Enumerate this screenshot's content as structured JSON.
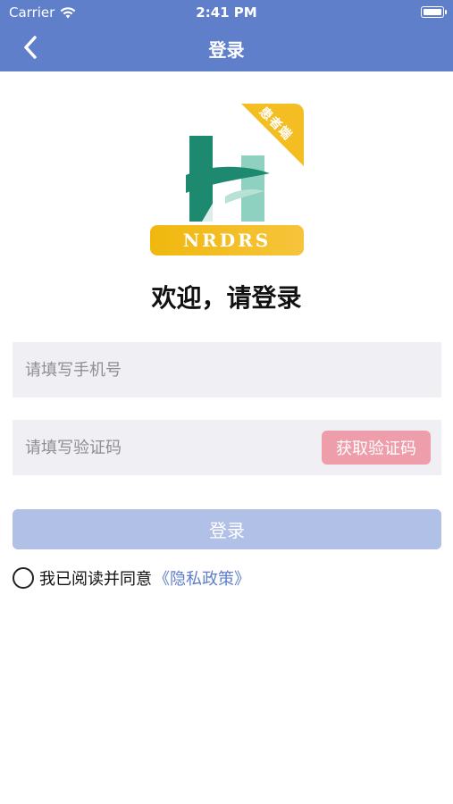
{
  "status_bar": {
    "carrier": "Carrier",
    "time": "2:41 PM"
  },
  "nav": {
    "title": "登录"
  },
  "logo": {
    "badge_text": "患者端",
    "banner_text": "NRDRS"
  },
  "welcome": "欢迎，请登录",
  "form": {
    "phone_placeholder": "请填写手机号",
    "code_placeholder": "请填写验证码",
    "get_code_label": "获取验证码",
    "login_label": "登录"
  },
  "agreement": {
    "text": "我已阅读并同意",
    "policy_link": "《隐私政策》"
  },
  "colors": {
    "primary": "#5f7fcb",
    "login_disabled": "#b1c0e6",
    "get_code": "#ee9eaa",
    "logo_gold": "#f4bd22",
    "logo_green": "#1d8a6f"
  }
}
